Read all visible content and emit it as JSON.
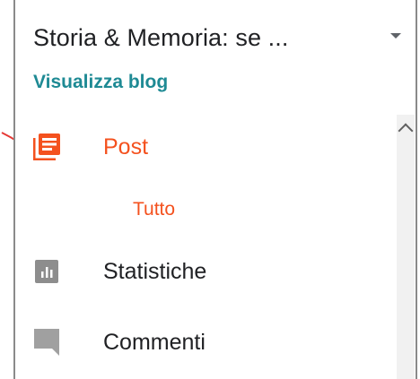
{
  "header": {
    "blog_title": "Storia & Memoria: se ...",
    "view_blog_label": "Visualizza blog"
  },
  "nav": {
    "posts": {
      "label": "Post",
      "icon": "posts-icon",
      "active": true,
      "sub_items": [
        {
          "label": "Tutto"
        }
      ]
    },
    "stats": {
      "label": "Statistiche",
      "icon": "bar-chart-icon"
    },
    "comments": {
      "label": "Commenti",
      "icon": "comment-icon"
    }
  },
  "colors": {
    "accent": "#f4511e",
    "link": "#1e8a94",
    "annotation": "#e53935",
    "icon_gray": "#8d8d8d",
    "text": "#202124"
  }
}
